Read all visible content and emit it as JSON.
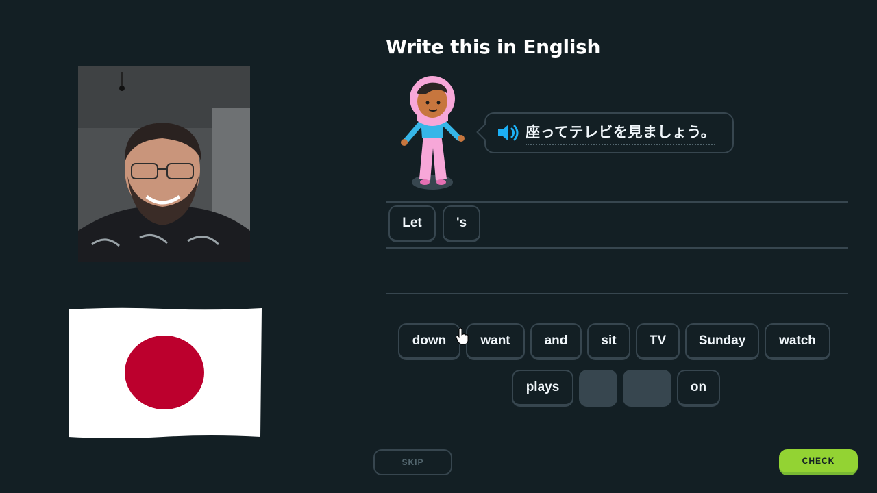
{
  "exercise": {
    "heading": "Write this in English",
    "prompt_sentence": "座ってテレビを見ましょう。",
    "speaker_icon": "speaker-icon",
    "character_icon": "character-illustration"
  },
  "answer": {
    "tiles": [
      "Let",
      "'s"
    ]
  },
  "word_bank": {
    "row1": [
      "down",
      "want",
      "and",
      "sit",
      "TV",
      "Sunday",
      "watch"
    ],
    "row2": [
      "plays",
      "",
      "",
      "on"
    ]
  },
  "footer": {
    "skip_label": "SKIP",
    "check_label": "CHECK"
  },
  "overlay": {
    "webcam": "webcam-feed",
    "flag": "japan-flag"
  },
  "colors": {
    "background": "#131f24",
    "tile_border": "#37464f",
    "check_green": "#93d333",
    "speaker_blue": "#1cb0f6",
    "flag_red": "#bc002d"
  }
}
